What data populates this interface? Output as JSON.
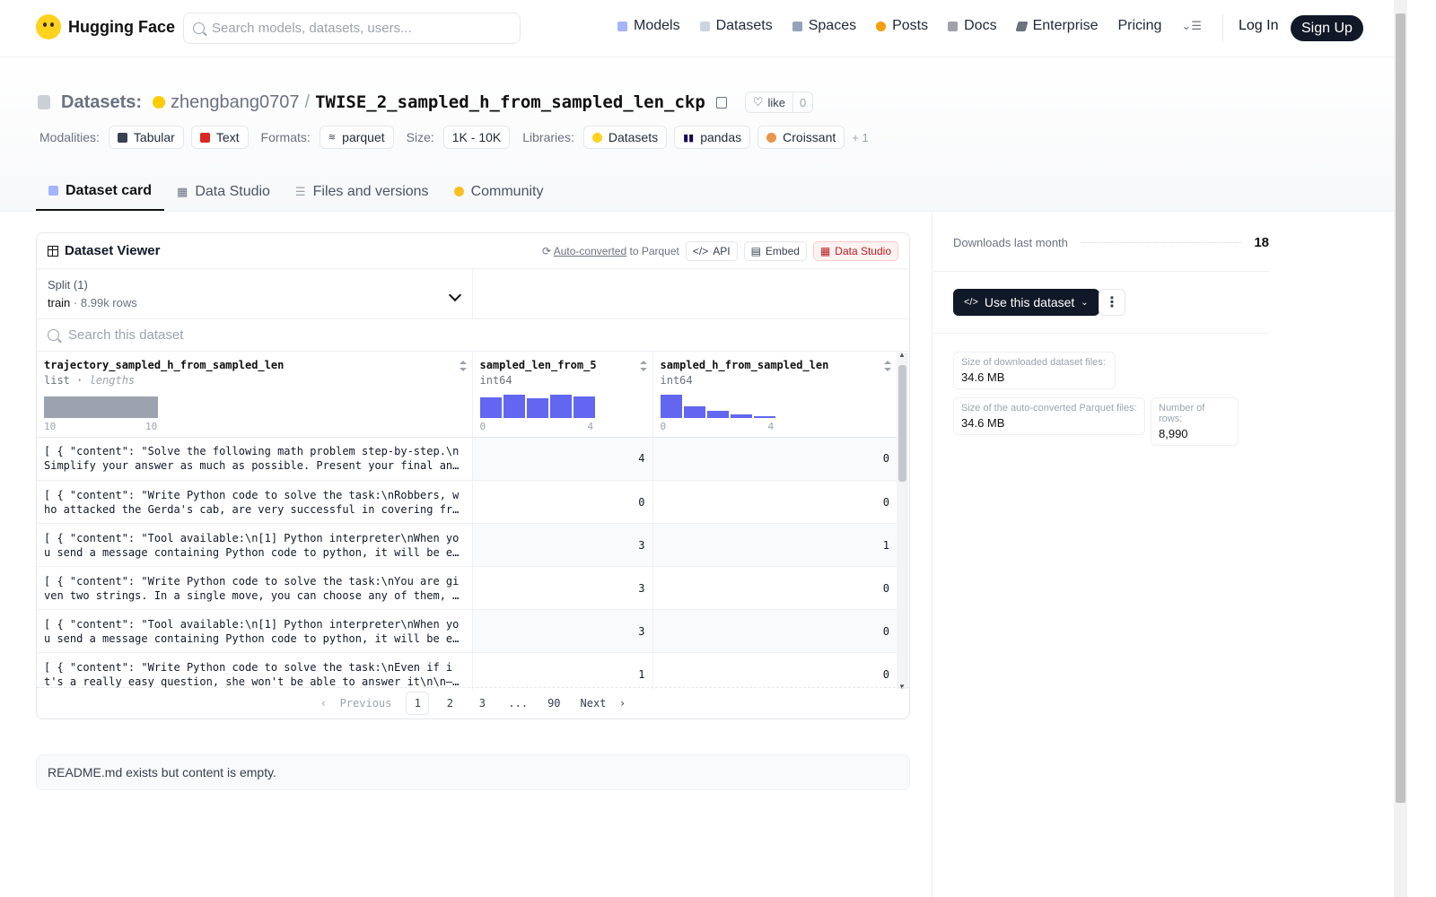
{
  "nav": {
    "brand": "Hugging Face",
    "search_placeholder": "Search models, datasets, users...",
    "items": [
      {
        "label": "Models",
        "icon": "models-icon",
        "color": "#a5b4fc"
      },
      {
        "label": "Datasets",
        "icon": "datasets-icon",
        "color": "#cbd5e1"
      },
      {
        "label": "Spaces",
        "icon": "spaces-icon",
        "color": "#94a3b8"
      },
      {
        "label": "Posts",
        "icon": "posts-icon",
        "color": "#f59e0b"
      },
      {
        "label": "Docs",
        "icon": "docs-icon",
        "color": "#a1a1aa"
      },
      {
        "label": "Enterprise",
        "icon": "enterprise-icon",
        "color": "#6b7280"
      },
      {
        "label": "Pricing",
        "icon": "",
        "color": ""
      }
    ],
    "login": "Log In",
    "signup": "Sign Up"
  },
  "header": {
    "crumb": "Datasets:",
    "owner": "zhengbang0707",
    "name": "TWISE_2_sampled_h_from_sampled_len_ckp",
    "like_label": "like",
    "like_count": "0",
    "modalities_label": "Modalities:",
    "modalities": [
      "Tabular",
      "Text"
    ],
    "formats_label": "Formats:",
    "format": "parquet",
    "size_label": "Size:",
    "size": "1K - 10K",
    "libraries_label": "Libraries:",
    "libraries": [
      "Datasets",
      "pandas",
      "Croissant"
    ],
    "libraries_more": "+ 1",
    "tabs": [
      "Dataset card",
      "Data Studio",
      "Files and versions",
      "Community"
    ]
  },
  "viewer": {
    "title": "Dataset Viewer",
    "auto_converted": "Auto-converted",
    "to_parquet": "to Parquet",
    "api": "API",
    "embed": "Embed",
    "data_studio": "Data Studio",
    "split_label": "Split (1)",
    "split_name": "train",
    "split_rows": "8.99k rows",
    "search_placeholder": "Search this dataset",
    "columns": [
      {
        "name": "trajectory_sampled_h_from_sampled_len",
        "type": "list",
        "sub": "lengths",
        "min": "10",
        "max": "10"
      },
      {
        "name": "sampled_len_from_5",
        "type": "int64",
        "sub": "",
        "min": "0",
        "max": "4",
        "hist": [
          0.9,
          1.0,
          0.85,
          1.0,
          0.92
        ]
      },
      {
        "name": "sampled_h_from_sampled_len",
        "type": "int64",
        "sub": "",
        "min": "0",
        "max": "4",
        "hist": [
          1.0,
          0.5,
          0.32,
          0.16,
          0.06
        ]
      }
    ],
    "rows": [
      {
        "text": "[ { \"content\": \"Solve the following math problem step-by-step.\\nSimplify your answer as much as possible. Present your final answer as \\boxed{Your Answer}.",
        "a": "4",
        "b": "0"
      },
      {
        "text": "[ { \"content\": \"Write Python code to solve the task:\\nRobbers, who attacked the Gerda's cab, are very successful in covering from the kingdom police.",
        "a": "0",
        "b": "0"
      },
      {
        "text": "[ { \"content\": \"Tool available:\\n[1] Python interpreter\\nWhen you send a message containing Python code to python, it will be executed in a stateful Jupyter notebook.",
        "a": "3",
        "b": "1"
      },
      {
        "text": "[ { \"content\": \"Write Python code to solve the task:\\nYou are given two strings. In a single move, you can choose any of them, and delete the first character.",
        "a": "3",
        "b": "0"
      },
      {
        "text": "[ { \"content\": \"Tool available:\\n[1] Python interpreter\\nWhen you send a message containing Python code to python, it will be executed in a stateful Jupyter notebook.",
        "a": "3",
        "b": "0"
      },
      {
        "text": "[ { \"content\": \"Write Python code to solve the task:\\nEven if it's a really easy question, she won't be able to answer it\\n\\n— Perfect Memento in Strict Sense",
        "a": "1",
        "b": "0"
      }
    ],
    "pager": {
      "prev": "Previous",
      "pages": [
        "1",
        "2",
        "3",
        "...",
        "90"
      ],
      "next": "Next"
    }
  },
  "readme": "README.md exists but content is empty.",
  "sidebar": {
    "downloads_label": "Downloads last month",
    "downloads": "18",
    "use_button": "Use this dataset",
    "size_dl_label": "Size of downloaded dataset files:",
    "size_dl": "34.6 MB",
    "size_pq_label": "Size of the auto-converted Parquet files:",
    "size_pq": "34.6 MB",
    "rows_label": "Number of rows:",
    "rows": "8,990"
  }
}
